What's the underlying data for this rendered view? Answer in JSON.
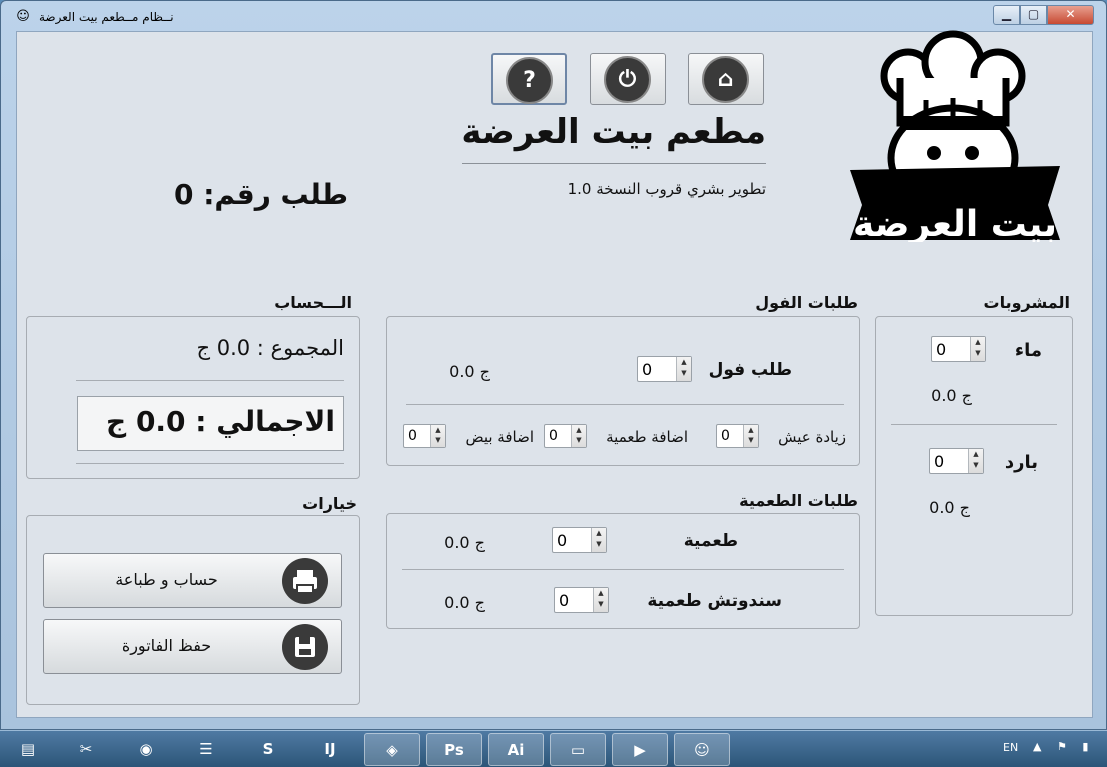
{
  "window": {
    "title": "نــظام مــطعم بيت العرضة",
    "controls": {
      "minimize": "▁",
      "maximize": "▢",
      "close": "✕"
    }
  },
  "header": {
    "restaurant_name": "مطعم بيت العرضة",
    "developer": "تطوير بشري قروب النسخة 1.0",
    "order_number": "طلب رقم: 0",
    "logo_text": "بيت العرضة",
    "buttons": {
      "help": "?",
      "power": "⏻",
      "home": "⌂"
    }
  },
  "account": {
    "title": "الـــحساب",
    "subtotal": "المجموع : 0.0 ج",
    "total": "الاجمالي : 0.0 ج"
  },
  "options": {
    "title": "خيارات",
    "calc_print": "حساب و طباعة",
    "save_invoice": "حفظ الفاتورة"
  },
  "foul_orders": {
    "title": "طلبات الفول",
    "foul_label": "طلب فول",
    "foul_qty": "0",
    "foul_price": "0.0 ج",
    "extra_bread_label": "زيادة عيش",
    "extra_bread_qty": "0",
    "add_taameya_label": "اضافة طعمية",
    "add_taameya_qty": "0",
    "add_egg_label": "اضافة بيض",
    "add_egg_qty": "0"
  },
  "taameya_orders": {
    "title": "طلبات الطعمية",
    "taameya_label": "طعمية",
    "taameya_qty": "0",
    "taameya_price": "0.0 ج",
    "sandwich_label": "سندوتش طعمية",
    "sandwich_qty": "0",
    "sandwich_price": "0.0 ج"
  },
  "drinks": {
    "title": "المشروبات",
    "water_label": "ماء",
    "water_qty": "0",
    "water_price": "0.0 ج",
    "cold_label": "بارد",
    "cold_qty": "0",
    "cold_price": "0.0 ج"
  },
  "spinner_arrows": {
    "up": "▲",
    "down": "▼"
  },
  "taskbar": {
    "language": "EN",
    "tray": "▲ ⚑ ▮",
    "apps": [
      {
        "name": "explorer-app",
        "glyph": "▤"
      },
      {
        "name": "tools-app",
        "glyph": "✂"
      },
      {
        "name": "chrome-app",
        "glyph": "◉"
      },
      {
        "name": "books-app",
        "glyph": "☰"
      },
      {
        "name": "sublime-app",
        "glyph": "S"
      },
      {
        "name": "intellij-app",
        "glyph": "IJ"
      },
      {
        "name": "virtualbox-app",
        "glyph": "◈"
      },
      {
        "name": "photoshop-app",
        "glyph": "Ps"
      },
      {
        "name": "illustrator-app",
        "glyph": "Ai"
      },
      {
        "name": "folder-app",
        "glyph": "▭"
      },
      {
        "name": "media-player-app",
        "glyph": "▶"
      },
      {
        "name": "restaurant-app",
        "glyph": "☺"
      }
    ]
  },
  "colors": {
    "window_bg": "#dde3ea",
    "titlebar": "#bcd3ea",
    "close_button": "#c74a33",
    "taskbar": "#2c5578"
  }
}
